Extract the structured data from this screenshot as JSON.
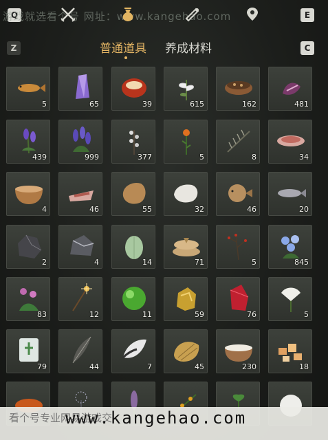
{
  "top_bar": {
    "left_key": "Q",
    "right_key": "E",
    "icons": [
      "crossed-swords-icon",
      "money-pouch-icon",
      "scroll-icon",
      "pin-icon"
    ],
    "watermark": "游戏就选看个号 网址：www.kangehao.com"
  },
  "tabs": {
    "prev_key": "Z",
    "next_key": "C",
    "items": [
      {
        "label": "普通道具",
        "active": true
      },
      {
        "label": "养成材料",
        "active": false
      }
    ]
  },
  "inventory": {
    "items": [
      {
        "name": "carp",
        "qty": "5"
      },
      {
        "name": "amethyst",
        "qty": "65"
      },
      {
        "name": "red-stone",
        "qty": "39"
      },
      {
        "name": "white-herb",
        "qty": "615"
      },
      {
        "name": "seed-bowl",
        "qty": "162"
      },
      {
        "name": "purple-flower",
        "qty": "481"
      },
      {
        "name": "lavender",
        "qty": "439"
      },
      {
        "name": "lavender-bunch",
        "qty": "999"
      },
      {
        "name": "white-blossom",
        "qty": "377"
      },
      {
        "name": "orange-flower",
        "qty": "5"
      },
      {
        "name": "pine-branch",
        "qty": "8"
      },
      {
        "name": "raw-meat",
        "qty": "34"
      },
      {
        "name": "soup-bowl",
        "qty": "4"
      },
      {
        "name": "meat-slab",
        "qty": "46"
      },
      {
        "name": "fur-pelt",
        "qty": "55"
      },
      {
        "name": "white-fur",
        "qty": "32"
      },
      {
        "name": "pufferfish",
        "qty": "46"
      },
      {
        "name": "fish",
        "qty": "20"
      },
      {
        "name": "iron-ore",
        "qty": "2"
      },
      {
        "name": "silver-ore",
        "qty": "4"
      },
      {
        "name": "melon",
        "qty": "14"
      },
      {
        "name": "rice-cake",
        "qty": "71"
      },
      {
        "name": "red-berry-branch",
        "qty": "5"
      },
      {
        "name": "blue-flower",
        "qty": "845"
      },
      {
        "name": "pink-flower",
        "qty": "83"
      },
      {
        "name": "spark-stick",
        "qty": "12"
      },
      {
        "name": "green-orb",
        "qty": "11"
      },
      {
        "name": "gold-nugget",
        "qty": "59"
      },
      {
        "name": "ruby",
        "qty": "76"
      },
      {
        "name": "white-lily",
        "qty": "5"
      },
      {
        "name": "jade-token",
        "qty": "79"
      },
      {
        "name": "feather",
        "qty": "44"
      },
      {
        "name": "fox-tail",
        "qty": "7"
      },
      {
        "name": "golden-shell",
        "qty": "45"
      },
      {
        "name": "milk-bowl",
        "qty": "230"
      },
      {
        "name": "citrine-chunks",
        "qty": "18"
      },
      {
        "name": "orange-stone",
        "qty": ""
      },
      {
        "name": "silver-thistle",
        "qty": ""
      },
      {
        "name": "purple-spike",
        "qty": ""
      },
      {
        "name": "fruit-branch",
        "qty": ""
      },
      {
        "name": "green-sprout",
        "qty": ""
      },
      {
        "name": "snowball",
        "qty": ""
      }
    ]
  },
  "banner": {
    "cn": "看个号专业网易游戏交",
    "url": "www.kangehao.com"
  }
}
